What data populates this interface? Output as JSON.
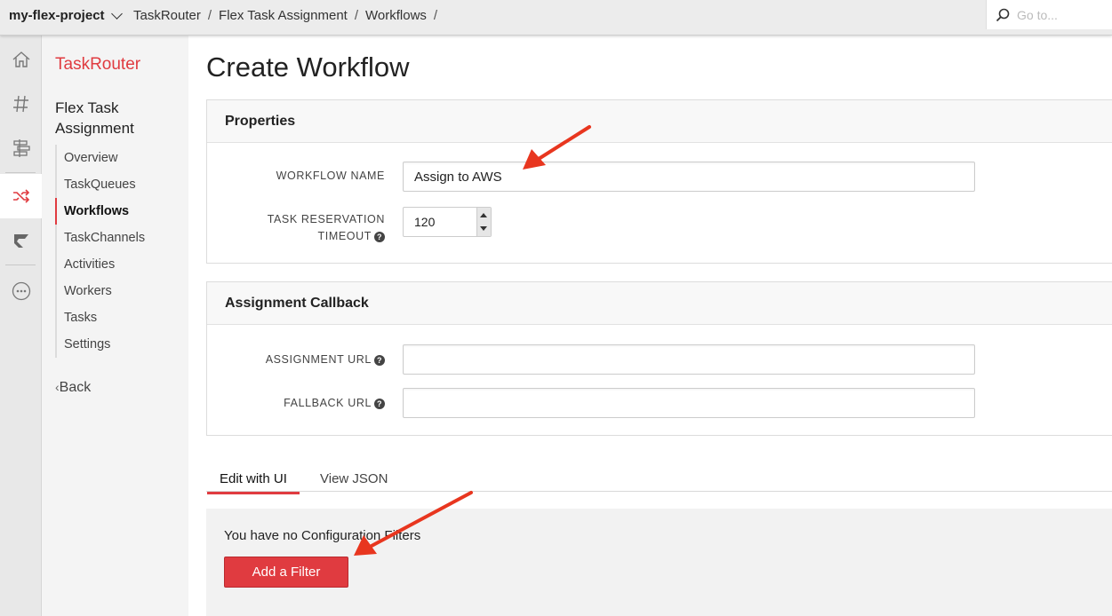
{
  "topbar": {
    "project": "my-flex-project",
    "breadcrumbs": [
      "TaskRouter",
      "/",
      "Flex Task Assignment",
      "/",
      "Workflows",
      "/"
    ],
    "search_placeholder": "Go to..."
  },
  "rail": {
    "icons": [
      "home-icon",
      "hash-icon",
      "sliders-icon",
      "shuffle-icon",
      "flag-icon",
      "more-icon"
    ],
    "active": "shuffle-icon"
  },
  "subnav": {
    "product": "TaskRouter",
    "section": "Flex Task Assignment",
    "items": [
      {
        "label": "Overview"
      },
      {
        "label": "TaskQueues"
      },
      {
        "label": "Workflows",
        "active": true
      },
      {
        "label": "TaskChannels"
      },
      {
        "label": "Activities"
      },
      {
        "label": "Workers"
      },
      {
        "label": "Tasks"
      },
      {
        "label": "Settings"
      }
    ],
    "back": "Back"
  },
  "main": {
    "title": "Create Workflow",
    "properties": {
      "header": "Properties",
      "workflow_name_label": "WORKFLOW NAME",
      "workflow_name_value": "Assign to AWS",
      "timeout_label_line1": "TASK RESERVATION",
      "timeout_label_line2": "TIMEOUT",
      "timeout_value": "120"
    },
    "callback": {
      "header": "Assignment Callback",
      "assignment_url_label": "ASSIGNMENT URL",
      "assignment_url_value": "",
      "fallback_url_label": "FALLBACK URL",
      "fallback_url_value": ""
    },
    "tabs": [
      {
        "label": "Edit with UI",
        "active": true
      },
      {
        "label": "View JSON",
        "active": false
      }
    ],
    "filters": {
      "empty_text": "You have no Configuration Filters",
      "add_button": "Add a Filter"
    }
  },
  "colors": {
    "accent": "#e03b40",
    "annotation_arrow": "#e8361f"
  }
}
